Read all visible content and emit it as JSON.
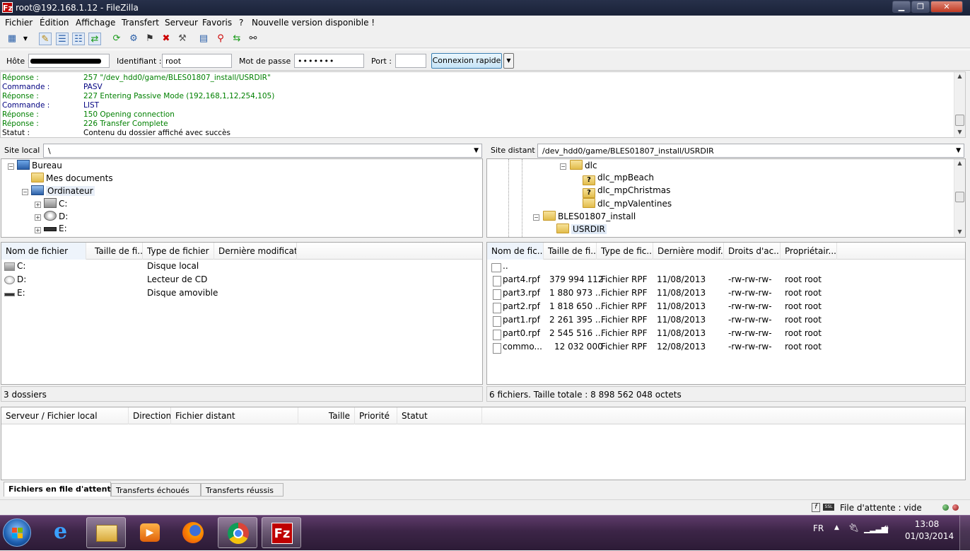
{
  "window": {
    "title": "root@192.168.1.12 - FileZilla",
    "app_icon": "Fz",
    "buttons": {
      "minimize": "▁",
      "maximize": "❐",
      "close": "✕"
    }
  },
  "menu": [
    "Fichier",
    "Édition",
    "Affichage",
    "Transfert",
    "Serveur",
    "Favoris",
    "?",
    "Nouvelle version disponible !"
  ],
  "quickconnect": {
    "host_label": "Hôte :",
    "host_value": "",
    "user_label": "Identifiant :",
    "user_value": "root",
    "pass_label": "Mot de passe :",
    "pass_value": "•••••••",
    "port_label": "Port :",
    "port_value": "",
    "connect_button": "Connexion rapide",
    "dropdown_glyph": "▼"
  },
  "log": [
    {
      "key": "Réponse :",
      "val": "257 \"/dev_hdd0/game/BLES01807_install/USRDIR\"",
      "type": "response"
    },
    {
      "key": "Commande :",
      "val": "PASV",
      "type": "command"
    },
    {
      "key": "Réponse :",
      "val": "227 Entering Passive Mode (192,168,1,12,254,105)",
      "type": "response"
    },
    {
      "key": "Commande :",
      "val": "LIST",
      "type": "command"
    },
    {
      "key": "Réponse :",
      "val": "150 Opening connection",
      "type": "response"
    },
    {
      "key": "Réponse :",
      "val": "226 Transfer Complete",
      "type": "response"
    },
    {
      "key": "Statut :",
      "val": "Contenu du dossier affiché avec succès",
      "type": "status"
    }
  ],
  "local": {
    "site_label": "Site local :",
    "path": "\\",
    "tree": [
      {
        "label": "Bureau",
        "indent": 0,
        "icon": "desktop-icon",
        "expander": "−"
      },
      {
        "label": "Mes documents",
        "indent": 1,
        "icon": "folder-icon",
        "expander": ""
      },
      {
        "label": "Ordinateur",
        "indent": 1,
        "icon": "computer-icon",
        "expander": "−",
        "selected": true
      },
      {
        "label": "C:",
        "indent": 2,
        "icon": "drive-icon",
        "expander": "+"
      },
      {
        "label": "D:",
        "indent": 2,
        "icon": "cd-drive-icon",
        "expander": "+"
      },
      {
        "label": "E:",
        "indent": 2,
        "icon": "removable-drive-icon",
        "expander": "+"
      }
    ],
    "columns": [
      "Nom de fichier",
      "Taille de fi...",
      "Type de fichier",
      "Dernière modificat..."
    ],
    "files": [
      {
        "name": "C:",
        "size": "",
        "type": "Disque local",
        "icon": "drive-icon"
      },
      {
        "name": "D:",
        "size": "",
        "type": "Lecteur de CD",
        "icon": "cd-drive-icon"
      },
      {
        "name": "E:",
        "size": "",
        "type": "Disque amovible",
        "icon": "removable-drive-icon"
      }
    ],
    "status": "3 dossiers"
  },
  "remote": {
    "site_label": "Site distant :",
    "path": "/dev_hdd0/game/BLES01807_install/USRDIR",
    "tree": [
      {
        "label": "dlc",
        "indent": 0,
        "icon": "folder-icon",
        "expander": "−"
      },
      {
        "label": "dlc_mpBeach",
        "indent": 1,
        "icon": "unknown-folder-icon",
        "expander": ""
      },
      {
        "label": "dlc_mpChristmas",
        "indent": 1,
        "icon": "unknown-folder-icon",
        "expander": ""
      },
      {
        "label": "dlc_mpValentines",
        "indent": 1,
        "icon": "folder-icon",
        "expander": ""
      },
      {
        "label": "BLES01807_install",
        "indent": -1,
        "icon": "folder-icon",
        "expander": "−"
      },
      {
        "label": "USRDIR",
        "indent": 0,
        "icon": "folder-icon",
        "expander": "",
        "selected": true
      }
    ],
    "columns": [
      "Nom de fic...",
      "Taille de fi...",
      "Type de fic...",
      "Dernière modif...",
      "Droits d'ac...",
      "Propriétair..."
    ],
    "files": [
      {
        "name": "..",
        "size": "",
        "type": "",
        "date": "",
        "perms": "",
        "owner": "",
        "icon": "folder-icon"
      },
      {
        "name": "part4.rpf",
        "size": "379 994 112",
        "type": "Fichier RPF",
        "date": "11/08/2013",
        "perms": "-rw-rw-rw-",
        "owner": "root root",
        "icon": "file-icon"
      },
      {
        "name": "part3.rpf",
        "size": "1 880 973 ...",
        "type": "Fichier RPF",
        "date": "11/08/2013",
        "perms": "-rw-rw-rw-",
        "owner": "root root",
        "icon": "file-icon"
      },
      {
        "name": "part2.rpf",
        "size": "1 818 650 ...",
        "type": "Fichier RPF",
        "date": "11/08/2013",
        "perms": "-rw-rw-rw-",
        "owner": "root root",
        "icon": "file-icon"
      },
      {
        "name": "part1.rpf",
        "size": "2 261 395 ...",
        "type": "Fichier RPF",
        "date": "11/08/2013",
        "perms": "-rw-rw-rw-",
        "owner": "root root",
        "icon": "file-icon"
      },
      {
        "name": "part0.rpf",
        "size": "2 545 516 ...",
        "type": "Fichier RPF",
        "date": "11/08/2013",
        "perms": "-rw-rw-rw-",
        "owner": "root root",
        "icon": "file-icon"
      },
      {
        "name": "commo...",
        "size": "12 032 000",
        "type": "Fichier RPF",
        "date": "12/08/2013",
        "perms": "-rw-rw-rw-",
        "owner": "root root",
        "icon": "file-icon"
      }
    ],
    "status": "6 fichiers. Taille totale : 8 898 562 048 octets"
  },
  "queue": {
    "columns": [
      "Serveur / Fichier local",
      "Direction",
      "Fichier distant",
      "Taille",
      "Priorité",
      "Statut"
    ]
  },
  "tabs": [
    "Fichiers en file d'attente",
    "Transferts échoués",
    "Transferts réussis"
  ],
  "statusbar": {
    "queue": "File d'attente : vide"
  },
  "taskbar": {
    "apps": [
      "internet-explorer-icon",
      "explorer-icon",
      "media-player-icon",
      "firefox-icon",
      "chrome-icon",
      "filezilla-icon"
    ],
    "lang": "FR",
    "time": "13:08",
    "date": "01/03/2014"
  },
  "colors": {
    "response": "#008000",
    "command": "#000080",
    "status": "#000000",
    "accent": "#3c7fb1"
  }
}
